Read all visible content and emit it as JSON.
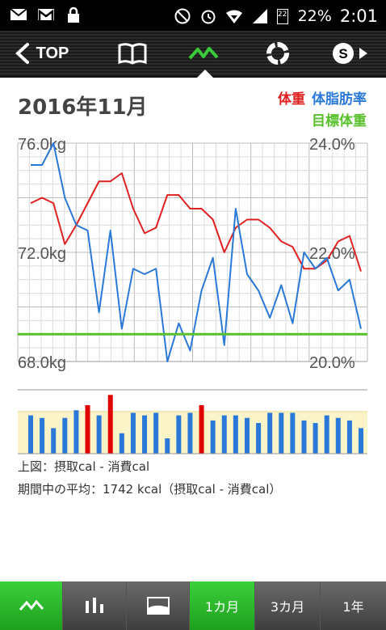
{
  "status_bar": {
    "battery": "22%",
    "time": "2:01",
    "signal_badge": "22",
    "icons": [
      "mail-icon",
      "gmail-icon",
      "lock-icon",
      "do-not-disturb-icon",
      "alarm-icon",
      "wifi-icon",
      "signal-icon",
      "battery-icon"
    ]
  },
  "toolbar": {
    "back_label": "TOP",
    "icons": [
      "book-icon",
      "graph-icon",
      "ring-icon",
      "s-forward-icon"
    ]
  },
  "header": {
    "month": "2016年11月",
    "legend_weight": "体重",
    "legend_fat": "体脂肪率",
    "legend_target": "目標体重"
  },
  "colors": {
    "weight": "#e02020",
    "fat": "#2a78d8",
    "target": "#58c02a",
    "bar_normal": "#2a78d8",
    "bar_high": "#e00000",
    "band": "#fbf4c8",
    "active_tab": "#26b826"
  },
  "chart_data": [
    {
      "type": "line",
      "x": [
        1,
        2,
        3,
        4,
        5,
        6,
        7,
        8,
        9,
        10,
        11,
        12,
        13,
        14,
        15,
        16,
        17,
        18,
        19,
        20,
        21,
        22,
        23,
        24,
        25,
        26,
        27,
        28,
        29,
        30
      ],
      "series": [
        {
          "name": "体重",
          "axis": "left",
          "values": [
            73.8,
            74.0,
            73.8,
            72.3,
            73.0,
            73.8,
            74.6,
            74.6,
            74.9,
            73.6,
            72.7,
            72.9,
            74.1,
            74.1,
            73.6,
            73.6,
            73.2,
            72.0,
            72.9,
            73.2,
            73.2,
            72.9,
            72.4,
            72.2,
            71.4,
            71.4,
            71.7,
            72.4,
            72.6,
            71.3
          ],
          "unit": "kg"
        },
        {
          "name": "体脂肪率",
          "axis": "right",
          "values": [
            23.6,
            23.6,
            24.0,
            23.0,
            22.5,
            22.4,
            20.9,
            22.4,
            20.6,
            21.7,
            21.6,
            21.7,
            20.0,
            20.7,
            20.2,
            21.3,
            21.9,
            20.3,
            22.8,
            21.6,
            21.3,
            20.8,
            21.4,
            20.7,
            22.0,
            21.7,
            21.9,
            21.3,
            21.5,
            20.6
          ],
          "unit": "%"
        },
        {
          "name": "目標体重",
          "axis": "left",
          "values": [
            69.0,
            69.0,
            69.0,
            69.0,
            69.0,
            69.0,
            69.0,
            69.0,
            69.0,
            69.0,
            69.0,
            69.0,
            69.0,
            69.0,
            69.0,
            69.0,
            69.0,
            69.0,
            69.0,
            69.0,
            69.0,
            69.0,
            69.0,
            69.0,
            69.0,
            69.0,
            69.0,
            69.0,
            69.0,
            69.0
          ],
          "unit": "kg"
        }
      ],
      "ylim_left": [
        68.0,
        76.0
      ],
      "ylim_right": [
        20.0,
        24.0
      ],
      "y_left_ticks": [
        "76.0kg",
        "72.0kg",
        "68.0kg"
      ],
      "y_right_ticks": [
        "24.0%",
        "22.0%",
        "20.0%"
      ],
      "grid": true
    },
    {
      "type": "bar",
      "x": [
        1,
        2,
        3,
        4,
        5,
        6,
        7,
        8,
        9,
        10,
        11,
        12,
        13,
        14,
        15,
        16,
        17,
        18,
        19,
        20,
        21,
        22,
        23,
        24,
        25,
        26,
        27,
        28,
        29,
        30
      ],
      "values": [
        300,
        280,
        200,
        280,
        340,
        380,
        300,
        460,
        160,
        320,
        300,
        320,
        120,
        300,
        320,
        380,
        260,
        300,
        300,
        280,
        240,
        320,
        320,
        320,
        260,
        240,
        300,
        280,
        260,
        200
      ],
      "high_flags": [
        false,
        false,
        false,
        false,
        false,
        true,
        false,
        true,
        false,
        false,
        false,
        false,
        false,
        false,
        false,
        true,
        false,
        false,
        false,
        false,
        false,
        false,
        false,
        false,
        false,
        false,
        false,
        false,
        false,
        false
      ],
      "ylim": [
        0,
        500
      ],
      "band": [
        0,
        330
      ],
      "grid": false
    }
  ],
  "notes": {
    "line1": "上図：摂取cal - 消費cal",
    "line2": "期間中の平均：1742 kcal（摂取cal - 消費cal）"
  },
  "bottom_bar": {
    "period_1": "1カ月",
    "period_3": "3カ月",
    "period_year": "1年",
    "icons": [
      "line-chart-icon",
      "bar-chart-icon",
      "area-chart-icon"
    ]
  }
}
